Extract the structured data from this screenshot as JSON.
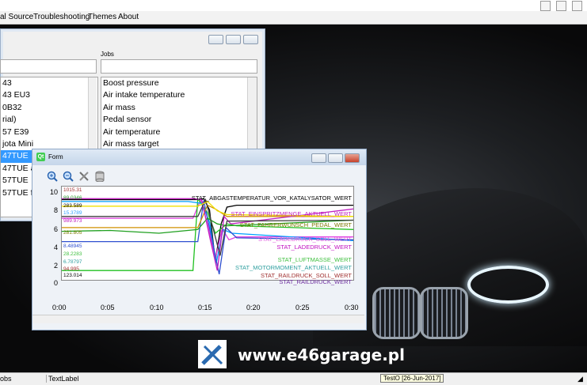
{
  "menubar": {
    "items": [
      "al Source",
      "Troubleshooting",
      "Themes",
      "About"
    ]
  },
  "main_window": {
    "jobs_label": "Jobs",
    "left_list": [
      "43",
      "43 EU3",
      "0B32",
      "rial)",
      "57 E39",
      "jota Mini",
      "47TUE",
      "47TUE al",
      "57TUE",
      "57TUE fr"
    ],
    "left_selected_index": 6,
    "jobs_list": [
      "Boost pressure",
      "Air intake temperature",
      "Air mass",
      "Pedal sensor",
      "Air temperature",
      "Air mass target"
    ]
  },
  "form_window": {
    "title": "Form",
    "qt_badge": "Qt",
    "toolbar_icons": [
      "zoom-in-icon",
      "zoom-out-icon",
      "tools-icon",
      "database-icon"
    ]
  },
  "chart_data": {
    "type": "line",
    "xlabel": "",
    "ylabel": "",
    "xlim": [
      0,
      30
    ],
    "ylim": [
      0,
      10
    ],
    "x_ticks": [
      "0:00",
      "0:05",
      "0:10",
      "0:15",
      "0:20",
      "0:25",
      "0:30"
    ],
    "y_ticks": [
      "10",
      "8",
      "6",
      "4",
      "2",
      "0"
    ],
    "grid": false,
    "series": [
      {
        "name": "STAT_ABGASTEMPERATUR_VOR_KATALYSATOR_WERT",
        "color": "#000000",
        "value_label": "1015.31"
      },
      {
        "name": "STAT_EINSPRITZMENGE_AKTUELL_WERT",
        "color": "#e040e0",
        "value_label": "283.589"
      },
      {
        "name": "STAT_FAHRERWUNSCH_PEDAL_WERT",
        "color": "#7a7a00",
        "value_label": "989.973"
      },
      {
        "name": "STAT_LADEDRUCK_SOLL_WERT",
        "color": "#e060e0",
        "value_label": "281.805"
      },
      {
        "name": "STAT_LADEDRUCK_WERT",
        "color": "#c010c0",
        "value_label": "8.48945"
      },
      {
        "name": "STAT_LUFTMASSE_WERT",
        "color": "#40c040",
        "value_label": "28.2283"
      },
      {
        "name": "STAT_MOTORMOMENT_AKTUELL_WERT",
        "color": "#30a0a0",
        "value_label": "6.78797"
      },
      {
        "name": "STAT_RAILDRUCK_SOLL_WERT",
        "color": "#a03030",
        "value_label": "94.995"
      },
      {
        "name": "STAT_RAILDRUCK_WERT",
        "color": "#7030a0",
        "value_label": "123.014"
      }
    ],
    "extra_value_labels": [
      "89.0346",
      "15.3789"
    ],
    "lines": [
      {
        "color": "#000000",
        "points": [
          [
            0,
            8.6
          ],
          [
            14,
            8.6
          ],
          [
            14.6,
            8.7
          ],
          [
            15.2,
            7.5
          ],
          [
            15.8,
            2.0
          ],
          [
            16.4,
            6.0
          ],
          [
            17,
            7.8
          ],
          [
            18,
            8.0
          ],
          [
            30,
            8.0
          ]
        ]
      },
      {
        "color": "#e040e0",
        "points": [
          [
            0,
            6.6
          ],
          [
            13.5,
            6.6
          ],
          [
            14.3,
            8.6
          ],
          [
            15,
            6.0
          ],
          [
            15.8,
            2.2
          ],
          [
            16.5,
            5.5
          ],
          [
            17.2,
            4.3
          ],
          [
            18,
            4.6
          ],
          [
            30,
            4.6
          ]
        ]
      },
      {
        "color": "#20c020",
        "points": [
          [
            0,
            1.0
          ],
          [
            13.5,
            1.0
          ],
          [
            14,
            8.7
          ],
          [
            15,
            7.2
          ],
          [
            15.8,
            5.0
          ],
          [
            17,
            6.0
          ],
          [
            18,
            5.8
          ],
          [
            30,
            5.4
          ]
        ]
      },
      {
        "color": "#00a0ff",
        "points": [
          [
            0,
            8.4
          ],
          [
            13,
            8.4
          ],
          [
            14.4,
            8.2
          ],
          [
            15.2,
            6.2
          ],
          [
            15.9,
            1.8
          ],
          [
            16.6,
            5.4
          ],
          [
            17.5,
            5.0
          ],
          [
            30,
            4.2
          ]
        ]
      },
      {
        "color": "#3050d0",
        "points": [
          [
            0,
            4.1
          ],
          [
            14,
            4.1
          ],
          [
            14.6,
            8.5
          ],
          [
            15.4,
            4.6
          ],
          [
            16.2,
            0.6
          ],
          [
            16.9,
            5.6
          ],
          [
            18,
            4.5
          ],
          [
            30,
            4.3
          ]
        ]
      },
      {
        "color": "#20a020",
        "points": [
          [
            0,
            5.2
          ],
          [
            5,
            5.3
          ],
          [
            10,
            5.0
          ],
          [
            14,
            5.4
          ],
          [
            15,
            6.6
          ],
          [
            16,
            6.0
          ],
          [
            17,
            5.8
          ],
          [
            30,
            6.4
          ]
        ]
      },
      {
        "color": "#d09000",
        "points": [
          [
            0,
            5.6
          ],
          [
            14,
            5.6
          ],
          [
            15,
            8.0
          ],
          [
            15.8,
            7.6
          ],
          [
            17,
            6.8
          ],
          [
            30,
            6.8
          ]
        ]
      },
      {
        "color": "#c020c0",
        "points": [
          [
            0,
            8.7
          ],
          [
            13.5,
            8.7
          ],
          [
            14.4,
            8.6
          ],
          [
            15.3,
            4.2
          ],
          [
            16,
            1.0
          ],
          [
            16.7,
            6.8
          ],
          [
            17.4,
            6.0
          ],
          [
            30,
            7.6
          ]
        ]
      },
      {
        "color": "#404040",
        "points": [
          [
            0,
            6.8
          ],
          [
            14,
            6.8
          ],
          [
            14.8,
            8.6
          ],
          [
            15.6,
            5.4
          ],
          [
            16.3,
            2.6
          ],
          [
            17,
            6.3
          ],
          [
            30,
            6.4
          ]
        ]
      },
      {
        "color": "#f0e000",
        "points": [
          [
            0,
            7.9
          ],
          [
            14,
            7.9
          ],
          [
            15,
            8.4
          ],
          [
            16,
            7.4
          ],
          [
            17,
            7.0
          ],
          [
            30,
            6.8
          ]
        ]
      }
    ]
  },
  "banner": {
    "text": "www.e46garage.pl"
  },
  "statusbar": {
    "left": "obs",
    "label": "TextLabel",
    "tooltip": "TestO [26-Jun-2017]"
  }
}
